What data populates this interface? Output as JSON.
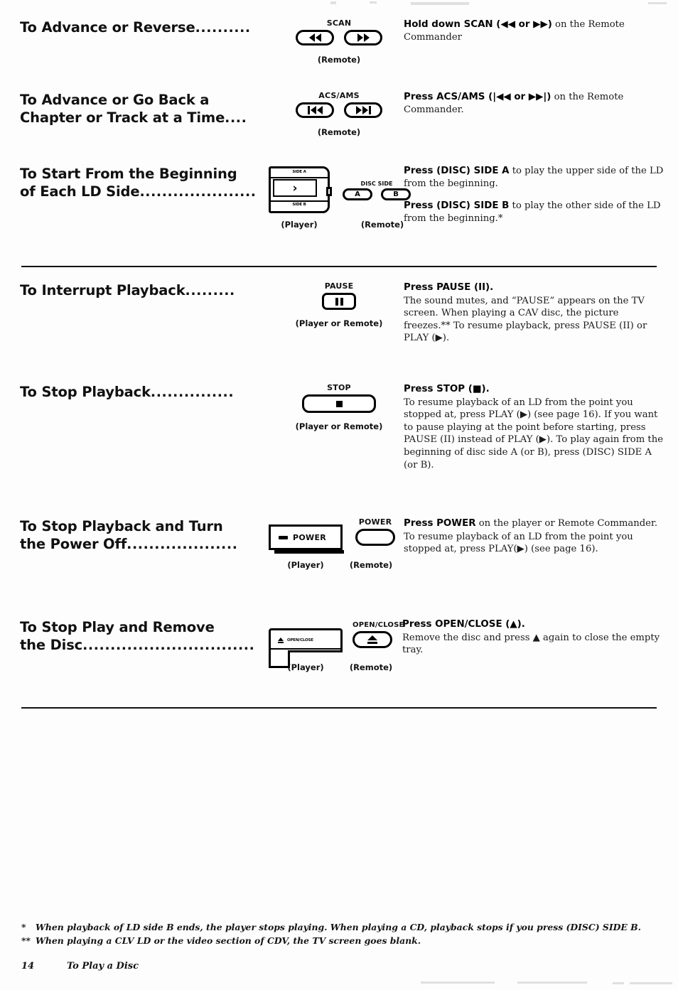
{
  "document": {
    "page_number": "14",
    "running_title": "To Play a Disc"
  },
  "sections": [
    {
      "heading": "To Advance or Reverse",
      "leader": "..........",
      "control_label": "SCAN",
      "source_captions": [
        "(Remote)"
      ],
      "buttons": [
        {
          "name": "scan-reverse",
          "symbol": "◀◀"
        },
        {
          "name": "scan-forward",
          "symbol": "▶▶"
        }
      ],
      "paragraphs": [
        {
          "lead": "Hold down SCAN (◀◀ or ▶▶)",
          "rest": " on the Remote Commander"
        }
      ]
    },
    {
      "heading_line1": "To Advance or Go Back a",
      "heading_line2": "Chapter or Track at a Time",
      "leader": "....",
      "control_label": "ACS/AMS",
      "source_captions": [
        "(Remote)"
      ],
      "buttons": [
        {
          "name": "acs-ams-previous",
          "symbol": "|◀◀"
        },
        {
          "name": "acs-ams-next",
          "symbol": "▶▶|"
        }
      ],
      "paragraphs": [
        {
          "lead": "Press ACS/AMS (|◀◀ or ▶▶|)",
          "rest": " on the Remote Commander."
        }
      ]
    },
    {
      "heading_line1": "To Start From the Beginning",
      "heading_line2": "of Each LD Side",
      "leader": ".....................",
      "control_label": "DISC SIDE",
      "source_captions": [
        "(Player)",
        "(Remote)"
      ],
      "player_display": {
        "top_tick": "SIDE A",
        "bottom_tick": "SIDE B",
        "screen_symbol": "›"
      },
      "buttons": [
        {
          "name": "disc-side-a",
          "symbol": "A"
        },
        {
          "name": "disc-side-b",
          "symbol": "B"
        }
      ],
      "paragraphs": [
        {
          "lead": "Press (DISC) SIDE A",
          "rest": " to play the upper side of the LD from the beginning."
        },
        {
          "lead": "Press (DISC) SIDE B",
          "rest": " to play the other side of the LD from the beginning.*"
        }
      ]
    },
    {
      "heading": "To Interrupt Playback",
      "leader": ".........",
      "control_label": "PAUSE",
      "source_captions": [
        "(Player or Remote)"
      ],
      "buttons": [
        {
          "name": "pause",
          "symbol": "‖"
        }
      ],
      "paragraphs": [
        {
          "lead": "Press PAUSE (II).",
          "rest": ""
        },
        {
          "lead": "",
          "rest": "The sound mutes, and “PAUSE” appears on the TV screen. When playing a CAV disc, the picture freezes.**  To resume playback, press PAUSE (II) or PLAY (▶)."
        }
      ]
    },
    {
      "heading": "To Stop Playback",
      "leader": "...............",
      "control_label": "STOP",
      "source_captions": [
        "(Player or Remote)"
      ],
      "buttons": [
        {
          "name": "stop",
          "symbol": "■"
        }
      ],
      "paragraphs": [
        {
          "lead": "Press STOP (■).",
          "rest": ""
        },
        {
          "lead": "",
          "rest": "To resume playback of an LD from the point you stopped at, press PLAY (▶) (see page 16). If you want to pause playing at the point before starting, press PAUSE (II) instead of PLAY (▶). To play again from the beginning of disc side A (or B), press (DISC) SIDE A (or B)."
        }
      ]
    },
    {
      "heading_line1": "To Stop Playback and Turn",
      "heading_line2": "the Power Off",
      "leader": "....................",
      "control_label": "POWER",
      "player_button_text": "POWER",
      "source_captions": [
        "(Player)",
        "(Remote)"
      ],
      "buttons": [
        {
          "name": "power",
          "symbol": ""
        }
      ],
      "paragraphs": [
        {
          "lead": "Press POWER",
          "rest": " on the player or Remote Commander."
        },
        {
          "lead": "",
          "rest": "To resume playback of an LD from the point you stopped at, press PLAY(▶) (see page 16)."
        }
      ]
    },
    {
      "heading_line1": "To Stop Play and Remove",
      "heading_line2": "the Disc",
      "leader": "...............................",
      "control_label": "OPEN/CLOSE",
      "player_button_text": "OPEN/CLOSE",
      "source_captions": [
        "(Player)",
        "(Remote)"
      ],
      "buttons": [
        {
          "name": "open-close",
          "symbol": "▲"
        }
      ],
      "paragraphs": [
        {
          "lead": "Press OPEN/CLOSE (▲).",
          "rest": ""
        },
        {
          "lead": "",
          "rest": "Remove the disc and press ▲ again to close the empty tray."
        }
      ]
    }
  ],
  "footnotes": [
    {
      "mark": "*",
      "text": "When playback of LD side B ends, the player stops playing. When playing a CD, playback stops if you press (DISC) SIDE B."
    },
    {
      "mark": "**",
      "text": "When playing a CLV LD or the video section of CDV, the TV screen goes blank."
    }
  ]
}
